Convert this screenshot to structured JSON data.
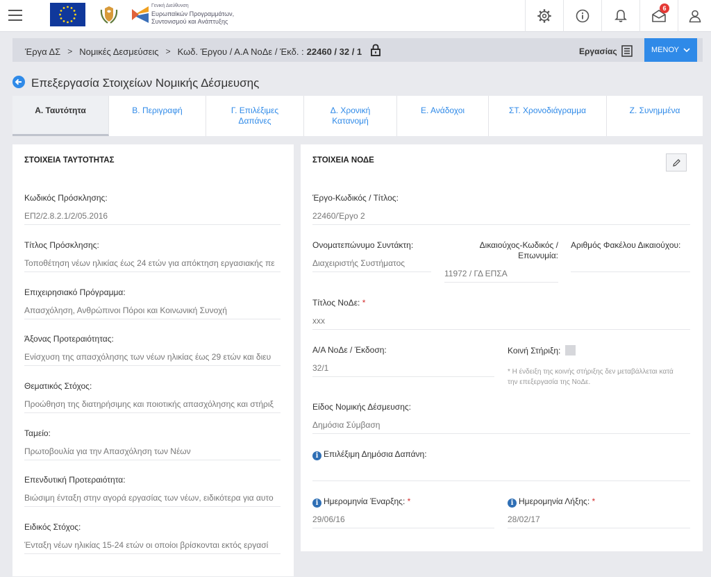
{
  "header": {
    "logo_lines": [
      "Γενική Διεύθυνση",
      "Ευρωπαϊκών Προγραμμάτων,",
      "Συντονισμού και Ανάπτυξης"
    ],
    "notification_count": "6",
    "icons": [
      "settings-icon",
      "info-icon",
      "bell-icon",
      "mail-icon",
      "user-icon"
    ]
  },
  "breadcrumb": {
    "items": [
      "Έργα ΔΣ",
      "Νομικές Δεσμεύσεις"
    ],
    "code_label": "Κωδ. Έργου / Α.Α ΝοΔε / Έκδ. :",
    "code_value": "22460 / 32 / 1",
    "work_label": "Εργασίας",
    "menu_label": "ΜΕΝΟΥ"
  },
  "page": {
    "title": "Επεξεργασία Στοιχείων Νομικής Δέσμευσης"
  },
  "tabs": [
    {
      "label": "Α. Ταυτότητα"
    },
    {
      "label": "Β. Περιγραφή"
    },
    {
      "label": "Γ. Επιλέξιμες Δαπάνες"
    },
    {
      "label": "Δ. Χρονική Κατανομή"
    },
    {
      "label": "Ε. Ανάδοχοι"
    },
    {
      "label": "ΣΤ. Χρονοδιάγραμμα"
    },
    {
      "label": "Ζ. Συνημμένα"
    }
  ],
  "identity": {
    "title": "ΣΤΟΙΧΕΙΑ ΤΑΥΤΟΤΗΤΑΣ",
    "fields": [
      {
        "label": "Κωδικός Πρόσκλησης:",
        "value": "ΕΠ2/2.8.2.1/2/05.2016"
      },
      {
        "label": "Τίτλος Πρόσκλησης:",
        "value": "Τοποθέτηση νέων ηλικίας έως 24 ετών για απόκτηση εργασιακής πε"
      },
      {
        "label": "Επιχειρησιακό Πρόγραμμα:",
        "value": "Απασχόληση, Ανθρώπινοι Πόροι και Κοινωνική Συνοχή"
      },
      {
        "label": "Άξονας Προτεραιότητας:",
        "value": "Ενίσχυση της απασχόλησης των νέων ηλικίας έως 29 ετών και διευ"
      },
      {
        "label": "Θεματικός Στόχος:",
        "value": "Προώθηση της διατηρήσιμης και ποιοτικής απασχόλησης και στήριξ"
      },
      {
        "label": "Ταμείο:",
        "value": "Πρωτοβουλία για την Απασχόληση των Νέων"
      },
      {
        "label": "Επενδυτική Προτεραιότητα:",
        "value": "Βιώσιμη ένταξη στην αγορά εργασίας των νέων, ειδικότερα για αυτο"
      },
      {
        "label": "Ειδικός Στόχος:",
        "value": "Ένταξη νέων ηλικίας 15-24 ετών οι οποίοι βρίσκονται εκτός εργασί"
      }
    ]
  },
  "node": {
    "title": "ΣΤΟΙΧΕΙΑ ΝΟΔΕ",
    "project_label": "Έργο-Κωδικός / Τίτλος:",
    "project_value": "22460/Έργο 2",
    "author_label": "Ονοματεπώνυμο Συντάκτη:",
    "author_value": "Διαχειριστής Συστήματος",
    "beneficiary_label_1": "Δικαιούχος-Κωδικός /",
    "beneficiary_label_2": "Επωνυμία:",
    "beneficiary_value": "11972 / ΓΔ ΕΠΣΑ",
    "folder_label": "Αριθμός Φακέλου Δικαιούχου:",
    "folder_value": "",
    "node_title_label": "Τίτλος ΝοΔε:",
    "node_title_value": "xxx",
    "aa_label": "Α/Α ΝοΔε / Έκδοση:",
    "aa_value": "32/1",
    "joint_label": "Κοινή Στήριξη:",
    "joint_note_1": "* Η ένδειξη της κοινής στήριξης δεν μεταβάλλεται κατά",
    "joint_note_2": "την επεξεργασία της ΝοΔε.",
    "type_label": "Είδος Νομικής Δέσμευσης:",
    "type_value": "Δημόσια Σύμβαση",
    "eligible_label": "Επιλέξιμη Δημόσια Δαπάνη:",
    "eligible_value": "",
    "start_label": "Ημερομηνία Έναρξης:",
    "start_value": "29/06/16",
    "end_label": "Ημερομηνία Λήξης:",
    "end_value": "28/02/17",
    "required_mark": "*"
  }
}
